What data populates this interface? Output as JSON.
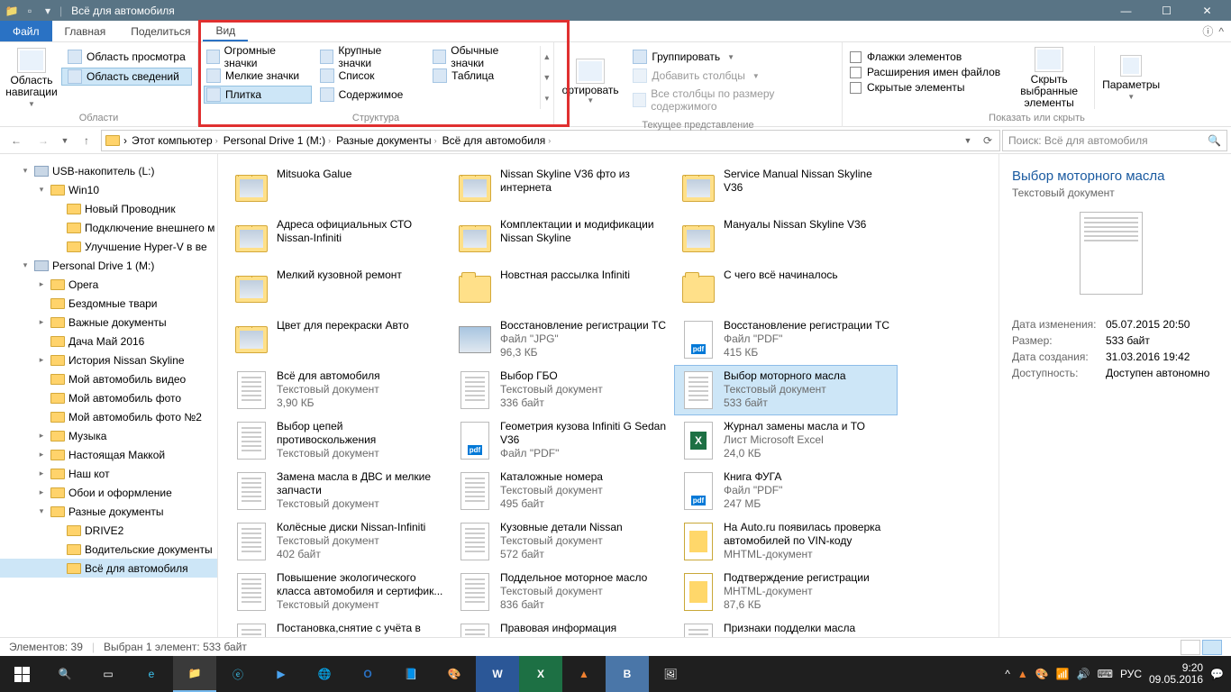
{
  "window": {
    "title": "Всё для автомобиля"
  },
  "tabs": {
    "file": "Файл",
    "home": "Главная",
    "share": "Поделиться",
    "view": "Вид"
  },
  "ribbon": {
    "panes": {
      "nav": "Область навигации",
      "preview": "Область просмотра",
      "details": "Область сведений",
      "group": "Области"
    },
    "layout": {
      "huge": "Огромные значки",
      "large": "Крупные значки",
      "medium": "Обычные значки",
      "small": "Мелкие значки",
      "list": "Список",
      "table": "Таблица",
      "tiles": "Плитка",
      "content": "Содержимое",
      "group": "Структура"
    },
    "sort": {
      "sort": "ортировать",
      "group_cmd": "Группировать",
      "addcol": "Добавить столбцы",
      "autosize": "Все столбцы по размеру содержимого",
      "group": "Текущее представление"
    },
    "show": {
      "chkboxes": "Флажки элементов",
      "ext": "Расширения имен файлов",
      "hidden": "Скрытые элементы",
      "hide": "Скрыть выбранные элементы",
      "options": "Параметры",
      "group": "Показать или скрыть"
    }
  },
  "breadcrumb": [
    "Этот компьютер",
    "Personal Drive 1 (M:)",
    "Разные документы",
    "Всё для автомобиля"
  ],
  "search": {
    "placeholder": "Поиск: Всё для автомобиля"
  },
  "tree": [
    {
      "d": 1,
      "icon": "drive",
      "label": "USB-накопитель (L:)",
      "exp": "▾"
    },
    {
      "d": 2,
      "icon": "folder",
      "label": "Win10",
      "exp": "▾"
    },
    {
      "d": 3,
      "icon": "folder",
      "label": "Новый Проводник"
    },
    {
      "d": 3,
      "icon": "folder",
      "label": "Подключение внешнего м"
    },
    {
      "d": 3,
      "icon": "folder",
      "label": "Улучшение Hyper-V в ве"
    },
    {
      "d": 1,
      "icon": "drive",
      "label": "Personal Drive 1 (M:)",
      "exp": "▾"
    },
    {
      "d": 2,
      "icon": "folder",
      "label": "Opera",
      "exp": "▸"
    },
    {
      "d": 2,
      "icon": "folder",
      "label": "Бездомные твари"
    },
    {
      "d": 2,
      "icon": "folder",
      "label": "Важные документы",
      "exp": "▸"
    },
    {
      "d": 2,
      "icon": "folder",
      "label": "Дача Май 2016"
    },
    {
      "d": 2,
      "icon": "folder",
      "label": "История Nissan Skyline",
      "exp": "▸"
    },
    {
      "d": 2,
      "icon": "folder",
      "label": "Мой автомобиль видео"
    },
    {
      "d": 2,
      "icon": "folder",
      "label": "Мой автомобиль фото"
    },
    {
      "d": 2,
      "icon": "folder",
      "label": "Мой автомобиль фото №2"
    },
    {
      "d": 2,
      "icon": "folder",
      "label": "Музыка",
      "exp": "▸"
    },
    {
      "d": 2,
      "icon": "folder",
      "label": "Настоящая Маккой",
      "exp": "▸"
    },
    {
      "d": 2,
      "icon": "folder",
      "label": "Наш кот",
      "exp": "▸"
    },
    {
      "d": 2,
      "icon": "folder",
      "label": "Обои и оформление",
      "exp": "▸"
    },
    {
      "d": 2,
      "icon": "folder",
      "label": "Разные документы",
      "exp": "▾"
    },
    {
      "d": 3,
      "icon": "folder",
      "label": "DRIVE2"
    },
    {
      "d": 3,
      "icon": "folder",
      "label": "Водительские документы"
    },
    {
      "d": 3,
      "icon": "folder",
      "label": "Всё для автомобиля",
      "sel": true
    }
  ],
  "files": [
    {
      "icon": "folderimg",
      "name": "Mitsuoka Galue"
    },
    {
      "icon": "folderimg",
      "name": "Nissan Skyline V36 фто из интернета"
    },
    {
      "icon": "folderimg",
      "name": "Service Manual Nissan Skyline V36"
    },
    {
      "icon": "folderimg",
      "name": "Адреса официальных СТО Nissan-Infiniti"
    },
    {
      "icon": "folderimg",
      "name": "Комплектации и модификации Nissan Skyline"
    },
    {
      "icon": "folderimg",
      "name": "Мануалы Nissan Skyline V36"
    },
    {
      "icon": "folderimg",
      "name": "Мелкий кузовной ремонт"
    },
    {
      "icon": "folder",
      "name": "Новстная рассылка Infiniti"
    },
    {
      "icon": "folder",
      "name": "С чего всё начиналось"
    },
    {
      "icon": "folderimg",
      "name": "Цвет для перекраски Авто"
    },
    {
      "icon": "img",
      "name": "Восстановление регистрации ТС",
      "sub1": "Файл \"JPG\"",
      "sub2": "96,3 КБ"
    },
    {
      "icon": "pdf",
      "name": "Восстановление регистрации ТС",
      "sub1": "Файл \"PDF\"",
      "sub2": "415 КБ"
    },
    {
      "icon": "doc",
      "name": "Всё для автомобиля",
      "sub1": "Текстовый документ",
      "sub2": "3,90 КБ"
    },
    {
      "icon": "doc",
      "name": "Выбор ГБО",
      "sub1": "Текстовый документ",
      "sub2": "336 байт"
    },
    {
      "icon": "doc",
      "name": "Выбор моторного масла",
      "sub1": "Текстовый документ",
      "sub2": "533 байт",
      "sel": true
    },
    {
      "icon": "doc",
      "name": "Выбор цепей противоскольжения",
      "sub1": "Текстовый документ"
    },
    {
      "icon": "pdf",
      "name": "Геометрия кузова Infiniti G Sedan V36",
      "sub1": "Файл \"PDF\""
    },
    {
      "icon": "xls",
      "name": "Журнал замены масла и ТО",
      "sub1": "Лист Microsoft Excel",
      "sub2": "24,0 КБ"
    },
    {
      "icon": "doc",
      "name": "Замена масла в ДВС и мелкие запчасти",
      "sub1": "Текстовый документ"
    },
    {
      "icon": "doc",
      "name": "Каталожные номера",
      "sub1": "Текстовый документ",
      "sub2": "495 байт"
    },
    {
      "icon": "pdf",
      "name": "Книга ФУГА",
      "sub1": "Файл \"PDF\"",
      "sub2": "247 МБ"
    },
    {
      "icon": "doc",
      "name": "Колёсные диски Nissan-Infiniti",
      "sub1": "Текстовый документ",
      "sub2": "402 байт"
    },
    {
      "icon": "doc",
      "name": "Кузовные детали Nissan",
      "sub1": "Текстовый документ",
      "sub2": "572 байт"
    },
    {
      "icon": "mht",
      "name": "На Auto.ru появилась проверка автомобилей по VIN-коду",
      "sub1": "MHTML-документ"
    },
    {
      "icon": "doc",
      "name": "Повышение экологического класса автомобиля и сертифик...",
      "sub1": "Текстовый документ"
    },
    {
      "icon": "doc",
      "name": "Поддельное моторное масло",
      "sub1": "Текстовый документ",
      "sub2": "836 байт"
    },
    {
      "icon": "mht",
      "name": "Подтверждение регистрации",
      "sub1": "MHTML-документ",
      "sub2": "87,6 КБ"
    },
    {
      "icon": "doc",
      "name": "Постановка,снятие с учёта в"
    },
    {
      "icon": "doc",
      "name": "Правовая информация"
    },
    {
      "icon": "doc",
      "name": "Признаки подделки масла Nissan"
    }
  ],
  "details": {
    "title": "Выбор моторного масла",
    "type": "Текстовый документ",
    "rows": [
      {
        "k": "Дата изменения:",
        "v": "05.07.2015 20:50"
      },
      {
        "k": "Размер:",
        "v": "533 байт"
      },
      {
        "k": "Дата создания:",
        "v": "31.03.2016 19:42"
      },
      {
        "k": "Доступность:",
        "v": "Доступен автономно"
      }
    ]
  },
  "status": {
    "count": "Элементов: 39",
    "sel": "Выбран 1 элемент: 533 байт"
  },
  "tray": {
    "lang": "РУС",
    "time": "9:20",
    "date": "09.05.2016"
  }
}
